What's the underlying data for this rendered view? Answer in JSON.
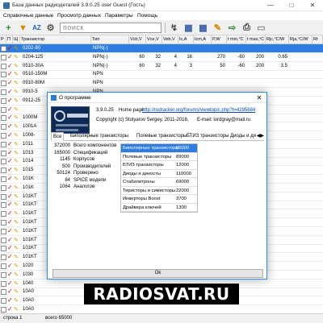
{
  "window": {
    "title": "База данных радиодеталей 3.9.0.25 user Guest (Гость)"
  },
  "menu": [
    "Справочные данные",
    "Просмотр данных",
    "Параметры",
    "Помощь"
  ],
  "toolbar": {
    "search_placeholder": "поиск"
  },
  "grid": {
    "columns": [
      "P",
      "П",
      "Щ",
      "Транзистор",
      "Тип",
      "Vcb,V",
      "Vce,V",
      "Veb,V",
      "Ic,A",
      "Icm,A",
      "P,W",
      "t min,°C",
      "t max,°C",
      "Rjc,°C/W",
      "Rja,°C/W",
      "Rt"
    ],
    "rows": [
      {
        "name": "0202-80",
        "type": "NPN(-)",
        "vcb": "",
        "vce": "",
        "veb": "",
        "ic": "",
        "icm": "",
        "p": "",
        "tmin": "",
        "tmax": "",
        "rjc": "",
        "rja": "",
        "selected": true
      },
      {
        "name": "0204-125",
        "type": "NPN(-)",
        "vcb": "60",
        "vce": "32",
        "veb": "4",
        "ic": "16",
        "icm": "",
        "p": "270",
        "tmin": "-60",
        "tmax": "200",
        "rjc": "0.65",
        "rja": "",
        "selected": false
      },
      {
        "name": "0510-30A",
        "type": "NPN(-)",
        "vcb": "60",
        "vce": "32",
        "veb": "4",
        "ic": "3",
        "icm": "",
        "p": "50",
        "tmin": "-60",
        "tmax": "200",
        "rjc": "3.5",
        "rja": "",
        "selected": false
      },
      {
        "name": "0510-150M",
        "type": "NPN",
        "vcb": "",
        "vce": "",
        "veb": "",
        "ic": "",
        "icm": "",
        "p": "",
        "tmin": "",
        "tmax": "",
        "rjc": "",
        "rja": "",
        "selected": false
      },
      {
        "name": "0910-80M",
        "type": "NPN",
        "vcb": "",
        "vce": "",
        "veb": "",
        "ic": "",
        "icm": "",
        "p": "",
        "tmin": "",
        "tmax": "",
        "rjc": "",
        "rja": "",
        "selected": false
      },
      {
        "name": "0910-5",
        "type": "NPN",
        "vcb": "",
        "vce": "",
        "veb": "",
        "ic": "",
        "icm": "",
        "p": "",
        "tmin": "",
        "tmax": "",
        "rjc": "",
        "rja": "",
        "selected": false
      },
      {
        "name": "0912-25",
        "type": "NPN",
        "vcb": "",
        "vce": "",
        "veb": "",
        "ic": "",
        "icm": "",
        "p": "",
        "tmin": "",
        "tmax": "",
        "rjc": "",
        "rja": "",
        "selected": false
      },
      {
        "name": "",
        "type": "",
        "vcb": "",
        "vce": "",
        "veb": "",
        "ic": "",
        "icm": "",
        "p": "",
        "tmin": "",
        "tmax": "",
        "rjc": "",
        "rja": "",
        "selected": false
      },
      {
        "name": "1000M",
        "type": "",
        "vcb": "",
        "vce": "",
        "veb": "",
        "ic": "",
        "icm": "",
        "p": "",
        "tmin": "",
        "tmax": "",
        "rjc": "",
        "rja": "",
        "selected": false
      },
      {
        "name": "1001A",
        "type": "",
        "vcb": "",
        "vce": "",
        "veb": "",
        "ic": "",
        "icm": "",
        "p": "",
        "tmin": "",
        "tmax": "",
        "rjc": "",
        "rja": "",
        "selected": false
      },
      {
        "name": "1008-",
        "type": "",
        "vcb": "",
        "vce": "",
        "veb": "",
        "ic": "",
        "icm": "",
        "p": "",
        "tmin": "",
        "tmax": "",
        "rjc": "",
        "rja": "",
        "selected": false
      },
      {
        "name": "1011",
        "type": "",
        "vcb": "",
        "vce": "",
        "veb": "",
        "ic": "",
        "icm": "",
        "p": "",
        "tmin": "",
        "tmax": "",
        "rjc": "",
        "rja": "",
        "selected": false
      },
      {
        "name": "1013",
        "type": "",
        "vcb": "",
        "vce": "",
        "veb": "",
        "ic": "",
        "icm": "",
        "p": "",
        "tmin": "",
        "tmax": "",
        "rjc": "",
        "rja": "",
        "selected": false
      },
      {
        "name": "1014",
        "type": "",
        "vcb": "",
        "vce": "",
        "veb": "",
        "ic": "",
        "icm": "",
        "p": "",
        "tmin": "",
        "tmax": "",
        "rjc": "",
        "rja": "",
        "selected": false
      },
      {
        "name": "1015",
        "type": "",
        "vcb": "",
        "vce": "",
        "veb": "",
        "ic": "",
        "icm": "",
        "p": "",
        "tmin": "",
        "tmax": "",
        "rjc": "",
        "rja": "",
        "selected": false
      },
      {
        "name": "101K",
        "type": "",
        "vcb": "",
        "vce": "",
        "veb": "",
        "ic": "",
        "icm": "",
        "p": "",
        "tmin": "",
        "tmax": "",
        "rjc": "",
        "rja": "",
        "selected": false
      },
      {
        "name": "101K",
        "type": "",
        "vcb": "",
        "vce": "",
        "veb": "",
        "ic": "",
        "icm": "",
        "p": "",
        "tmin": "",
        "tmax": "",
        "rjc": "",
        "rja": "",
        "selected": false
      },
      {
        "name": "101KT",
        "type": "",
        "vcb": "",
        "vce": "",
        "veb": "",
        "ic": "",
        "icm": "",
        "p": "",
        "tmin": "",
        "tmax": "",
        "rjc": "",
        "rja": "",
        "selected": false
      },
      {
        "name": "101KT",
        "type": "",
        "vcb": "",
        "vce": "",
        "veb": "",
        "ic": "",
        "icm": "",
        "p": "",
        "tmin": "",
        "tmax": "",
        "rjc": "",
        "rja": "",
        "selected": false
      },
      {
        "name": "101KT",
        "type": "",
        "vcb": "",
        "vce": "",
        "veb": "",
        "ic": "",
        "icm": "",
        "p": "",
        "tmin": "",
        "tmax": "",
        "rjc": "",
        "rja": "",
        "selected": false
      },
      {
        "name": "101KT",
        "type": "",
        "vcb": "",
        "vce": "",
        "veb": "",
        "ic": "",
        "icm": "",
        "p": "",
        "tmin": "",
        "tmax": "",
        "rjc": "",
        "rja": "",
        "selected": false
      },
      {
        "name": "101KT",
        "type": "",
        "vcb": "",
        "vce": "",
        "veb": "",
        "ic": "",
        "icm": "",
        "p": "",
        "tmin": "",
        "tmax": "",
        "rjc": "",
        "rja": "",
        "selected": false
      },
      {
        "name": "101KT",
        "type": "",
        "vcb": "",
        "vce": "",
        "veb": "",
        "ic": "",
        "icm": "",
        "p": "",
        "tmin": "",
        "tmax": "",
        "rjc": "",
        "rja": "",
        "selected": false
      },
      {
        "name": "101KT",
        "type": "",
        "vcb": "",
        "vce": "",
        "veb": "",
        "ic": "",
        "icm": "",
        "p": "",
        "tmin": "",
        "tmax": "",
        "rjc": "",
        "rja": "",
        "selected": false
      },
      {
        "name": "101KT",
        "type": "",
        "vcb": "",
        "vce": "",
        "veb": "",
        "ic": "",
        "icm": "",
        "p": "",
        "tmin": "",
        "tmax": "",
        "rjc": "",
        "rja": "",
        "selected": false
      },
      {
        "name": "1020",
        "type": "",
        "vcb": "",
        "vce": "",
        "veb": "",
        "ic": "",
        "icm": "",
        "p": "",
        "tmin": "",
        "tmax": "",
        "rjc": "",
        "rja": "",
        "selected": false
      },
      {
        "name": "1030",
        "type": "",
        "vcb": "",
        "vce": "",
        "veb": "",
        "ic": "",
        "icm": "",
        "p": "",
        "tmin": "",
        "tmax": "",
        "rjc": "",
        "rja": "",
        "selected": false
      },
      {
        "name": "1040",
        "type": "",
        "vcb": "",
        "vce": "",
        "veb": "",
        "ic": "",
        "icm": "",
        "p": "",
        "tmin": "",
        "tmax": "",
        "rjc": "",
        "rja": "",
        "selected": false
      },
      {
        "name": "10A0",
        "type": "",
        "vcb": "",
        "vce": "",
        "veb": "",
        "ic": "",
        "icm": "",
        "p": "",
        "tmin": "",
        "tmax": "",
        "rjc": "",
        "rja": "",
        "selected": false
      },
      {
        "name": "10A0",
        "type": "",
        "vcb": "",
        "vce": "",
        "veb": "",
        "ic": "",
        "icm": "",
        "p": "",
        "tmin": "",
        "tmax": "",
        "rjc": "",
        "rja": "",
        "selected": false
      },
      {
        "name": "10A0",
        "type": "",
        "vcb": "",
        "vce": "",
        "veb": "",
        "ic": "",
        "icm": "",
        "p": "",
        "tmin": "",
        "tmax": "",
        "rjc": "",
        "rja": "",
        "selected": false
      }
    ]
  },
  "status": {
    "row": "строка 1",
    "total": "всего 65000"
  },
  "about": {
    "title": "О программе",
    "version": "3.9.0.25",
    "home_label": "Home page:",
    "home_url": "http://rudracker.org/forums/viewtopic.php?t=4295684",
    "copyright": "Copyright (c) Stolyarov Sergey, 2011-2018,",
    "email": "E-mail: lordgray@mail.ru",
    "tabs": [
      "Все",
      "Биполярные транзисторы",
      "Полевые транзисторы",
      "БТИЗ транзисторы",
      "Диоды и диодных"
    ],
    "stats": [
      {
        "num": "372000",
        "label": "Всего компонентов"
      },
      {
        "num": "165000",
        "label": "Спецификаций"
      },
      {
        "num": "1145",
        "label": "Корпусов"
      },
      {
        "num": "500",
        "label": "Производителей"
      },
      {
        "num": "50124",
        "label": "Проверено"
      },
      {
        "num": "84",
        "label": "SPICE модели"
      },
      {
        "num": "1064",
        "label": "Аналогов"
      }
    ],
    "breakdown": [
      {
        "label": "Биполярные транзисторы",
        "value": "65000",
        "selected": true
      },
      {
        "label": "Полевые транзисторы",
        "value": "89000",
        "selected": false
      },
      {
        "label": "БТИЗ транзисторы",
        "value": "12000",
        "selected": false
      },
      {
        "label": "Диоды и диносты",
        "value": "110000",
        "selected": false
      },
      {
        "label": "Стабилитроны",
        "value": "69000",
        "selected": false
      },
      {
        "label": "Тиристоры и симисторы",
        "value": "22000",
        "selected": false
      },
      {
        "label": "Инверторы Boost",
        "value": "3700",
        "selected": false
      },
      {
        "label": "Драйвера ключей",
        "value": "1300",
        "selected": false
      }
    ],
    "ok_label": "Ok"
  },
  "watermark": "RADIOSVAT.RU"
}
